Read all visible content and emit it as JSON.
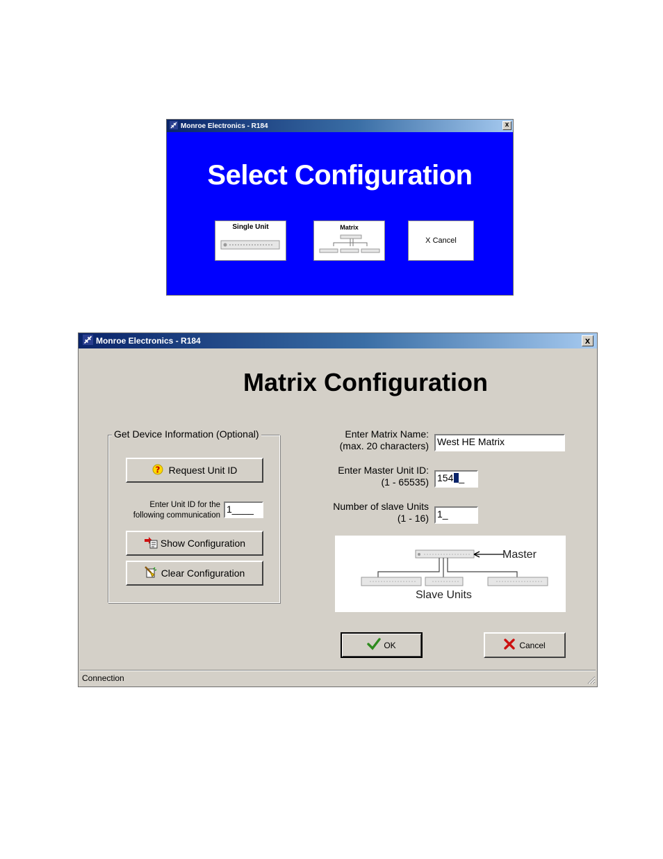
{
  "select_window": {
    "title": "Monroe Electronics - R184",
    "close_label": "x",
    "heading": "Select Configuration",
    "options": {
      "single_unit": "Single Unit",
      "matrix": "Matrix",
      "cancel": "X Cancel"
    },
    "colors": {
      "background": "#0000ff"
    }
  },
  "matrix_window": {
    "title": "Monroe Electronics - R184",
    "close_label": "x",
    "heading": "Matrix Configuration",
    "device_group": {
      "legend": "Get Device Information (Optional)",
      "request_unit_id": "Request Unit ID",
      "unit_id_label_line1": "Enter Unit ID for the",
      "unit_id_label_line2": "following communication",
      "unit_id_value": "1____",
      "show_configuration": "Show Configuration",
      "clear_configuration": "Clear Configuration"
    },
    "matrix_name": {
      "label_line1": "Enter Matrix Name:",
      "label_line2": "(max. 20 characters)",
      "value": "West HE Matrix"
    },
    "master_unit_id": {
      "label_line1": "Enter Master Unit ID:",
      "label_line2": "(1 - 65535)",
      "value": "154",
      "suffix": "_"
    },
    "slave_units": {
      "label_line1": "Number of slave Units",
      "label_line2": "(1 - 16)",
      "value": "1_"
    },
    "diagram": {
      "master_label": "Master",
      "slave_label": "Slave Units"
    },
    "ok_label": "OK",
    "cancel_label": "Cancel",
    "status_text": "Connection",
    "colors": {
      "panel": "#d4d0c8",
      "ok_check": "#2e8b1e",
      "cancel_x": "#cc1010"
    }
  }
}
